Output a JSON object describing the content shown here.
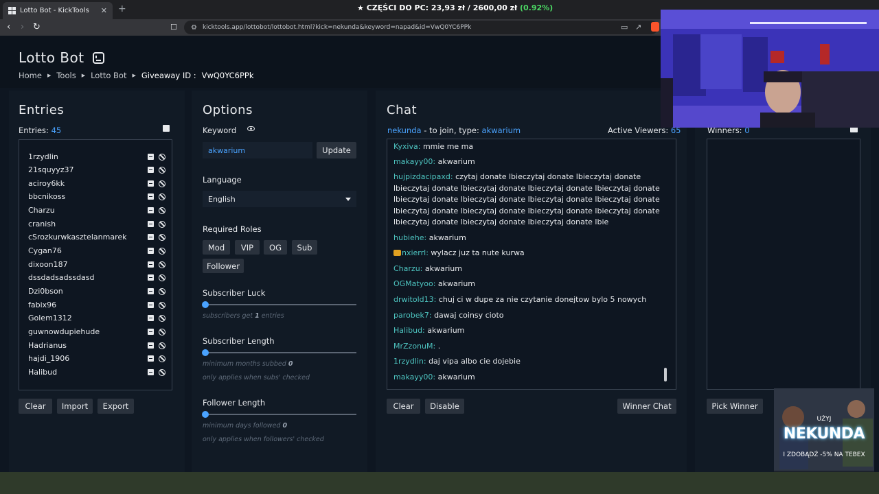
{
  "browser": {
    "tab_title": "Lotto Bot - KickTools",
    "tab_close": "✕",
    "new_tab": "+",
    "url": "kicktools.app/lottobot/lottobot.html?kick=nekunda&keyword=napad&id=VwQ0YC6PPk",
    "promo_star": "★",
    "promo_label": "CZĘŚCI DO PC:",
    "promo_price": "23,93 zł",
    "promo_sep": "/",
    "promo_total": "2600,00 zł",
    "promo_pct": "(0.92%)"
  },
  "header": {
    "title": "Lotto Bot",
    "breadcrumb": [
      "Home",
      "Tools",
      "Lotto Bot"
    ],
    "giveaway_label": "Giveaway ID :",
    "giveaway_id": "VwQ0YC6PPk"
  },
  "entries": {
    "title": "Entries",
    "count_label": "Entries:",
    "count": "45",
    "items": [
      "1rzydlin",
      "21squyyz37",
      "aciroy6kk",
      "bbcnikoss",
      "Charzu",
      "cranish",
      "cSrozkurwkasztelanmarek",
      "Cygan76",
      "dixoon187",
      "dssdadsadssdasd",
      "Dzi0bson",
      "fabix96",
      "Golem1312",
      "guwnowdupiehude",
      "Hadrianus",
      "hajdi_1906",
      "Halibud"
    ],
    "buttons": {
      "clear": "Clear",
      "import": "Import",
      "export": "Export"
    }
  },
  "options": {
    "title": "Options",
    "keyword_label": "Keyword",
    "keyword_value": "akwarium",
    "update_label": "Update",
    "language_label": "Language",
    "language_value": "English",
    "roles_label": "Required Roles",
    "roles": [
      "Mod",
      "VIP",
      "OG",
      "Sub",
      "Follower"
    ],
    "sub_luck_label": "Subscriber Luck",
    "sub_luck_hint_pre": "subscribers get",
    "sub_luck_value": "1",
    "sub_luck_hint_post": "entries",
    "sub_length_label": "Subscriber Length",
    "sub_length_hint": "minimum months subbed",
    "sub_length_value": "0",
    "sub_length_note": "only applies when subs' checked",
    "follow_length_label": "Follower Length",
    "follow_length_hint": "minimum days followed",
    "follow_length_value": "0",
    "follow_length_note": "only applies when followers' checked",
    "sub_luck_fraction": 0,
    "sub_length_fraction": 0,
    "follow_length_fraction": 0
  },
  "chat": {
    "title": "Chat",
    "channel": "nekunda",
    "join_text": "- to join, type:",
    "keyword": "akwarium",
    "viewers_label": "Active Viewers:",
    "viewers": "65",
    "messages": [
      {
        "user": "Kyxiva:",
        "text": "mmie me ma"
      },
      {
        "user": "makayy00:",
        "text": "akwarium"
      },
      {
        "user": "hujpizdacipaxd:",
        "text": "czytaj donate lbieczytaj donate lbieczytaj donate lbieczytaj donate lbieczytaj donate lbieczytaj donate lbieczytaj donate lbieczytaj donate lbieczytaj donate lbieczytaj donate lbieczytaj donate lbieczytaj donate lbieczytaj donate lbieczytaj donate lbieczytaj donate lbieczytaj donate lbieczytaj donate lbieczytaj donate lbie"
      },
      {
        "user": "hubiehe:",
        "text": "akwarium"
      },
      {
        "user": "nxierrl:",
        "text": "wylacz juz ta nute kurwa"
      },
      {
        "user": "Charzu:",
        "text": "akwarium"
      },
      {
        "user": "OGMatyoo:",
        "text": "akwarium"
      },
      {
        "user": "drwitold13:",
        "text": "chuj ci w dupe za nie czytanie donejtow bylo 5 nowych"
      },
      {
        "user": "parobek7:",
        "text": "dawaj coinsy cioto"
      },
      {
        "user": "Halibud:",
        "text": "akwarium"
      },
      {
        "user": "MrZzonuM:",
        "text": "."
      },
      {
        "user": "1rzydlin:",
        "text": "daj vipa albo cie dojebie"
      },
      {
        "user": "makayy00:",
        "text": "akwarium"
      }
    ],
    "buttons": {
      "clear": "Clear",
      "disable": "Disable",
      "winner_chat": "Winner Chat"
    }
  },
  "winners": {
    "count_label": "Winners:",
    "count": "0",
    "pick_label": "Pick Winner"
  },
  "overlay": {
    "use_label": "UŻYJ",
    "code": "NEKUNDA",
    "sale": "I ZDOBĄDŹ -5% NA TEBEX"
  },
  "colors": {
    "accent": "#4aa3ff",
    "chat_user": "#4ec5c1",
    "background": "#0e1621"
  }
}
